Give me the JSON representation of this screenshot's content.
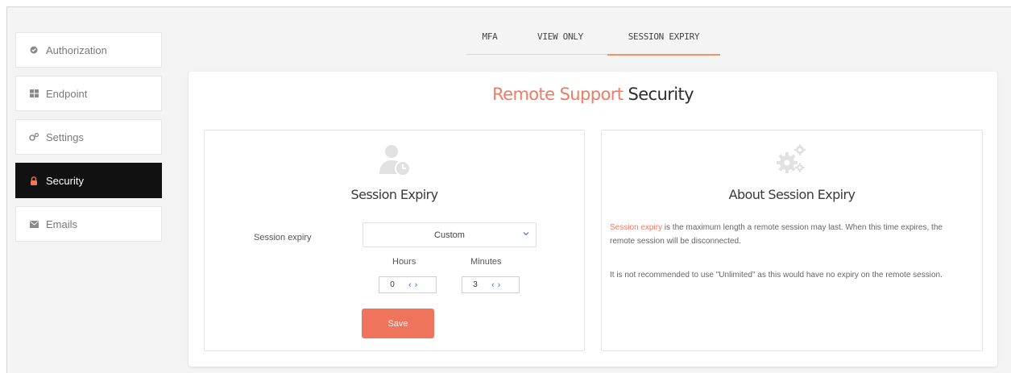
{
  "sidebar": {
    "items": [
      {
        "label": "Authorization",
        "icon": "check-circle-icon",
        "active": false
      },
      {
        "label": "Endpoint",
        "icon": "windows-icon",
        "active": false
      },
      {
        "label": "Settings",
        "icon": "gears-icon",
        "active": false
      },
      {
        "label": "Security",
        "icon": "lock-icon",
        "active": true
      },
      {
        "label": "Emails",
        "icon": "envelope-icon",
        "active": false
      }
    ]
  },
  "tabs": [
    {
      "label": "MFA",
      "active": false
    },
    {
      "label": "VIEW ONLY",
      "active": false
    },
    {
      "label": "SESSION EXPIRY",
      "active": true
    }
  ],
  "page": {
    "title_accent": "Remote Support",
    "title_rest": "Security"
  },
  "left_panel": {
    "heading": "Session Expiry",
    "icon": "user-clock-icon",
    "session_expiry_label": "Session expiry",
    "select_value": "Custom",
    "hours_label": "Hours",
    "minutes_label": "Minutes",
    "hours_value": "0",
    "minutes_value": "3",
    "save_label": "Save"
  },
  "right_panel": {
    "heading": "About Session Expiry",
    "icon": "gears-icon",
    "para1_highlight": "Session expiry",
    "para1_rest": " is the maximum length a remote session may last. When this time expires, the remote session will be disconnected.",
    "para2": "It is not recommended to use \"Unlimited\" as this would have no expiry on the remote session."
  },
  "colors": {
    "accent": "#f07a62",
    "active_sidebar_bg": "#111111",
    "tab_underline": "#f0965a",
    "stepper_arrow": "#3a7be0"
  }
}
